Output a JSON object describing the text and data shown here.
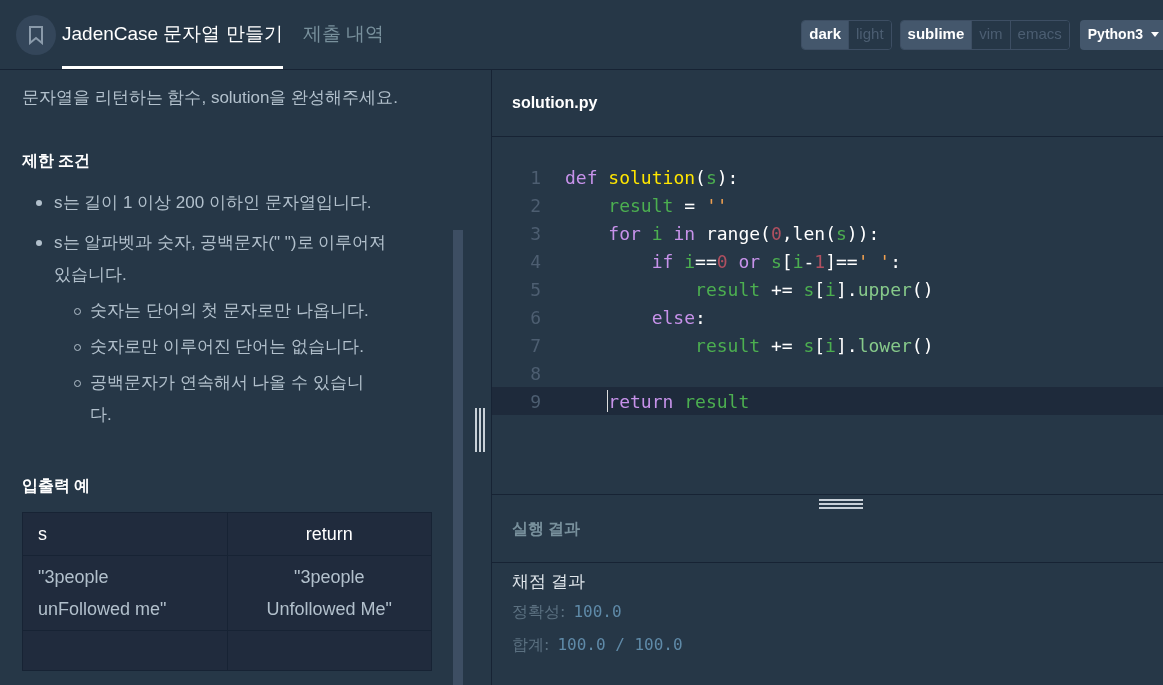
{
  "header": {
    "tabs": [
      {
        "label": "JadenCase 문자열 만들기",
        "selected": true
      },
      {
        "label": "제출 내역",
        "selected": false
      }
    ],
    "option_groups": [
      {
        "options": [
          {
            "label": "dark",
            "selected": true
          },
          {
            "label": "light",
            "selected": false
          }
        ]
      },
      {
        "options": [
          {
            "label": "sublime",
            "selected": true
          },
          {
            "label": "vim",
            "selected": false
          },
          {
            "label": "emacs",
            "selected": false
          }
        ]
      }
    ],
    "language": "Python3"
  },
  "description": {
    "intro": "문자열을 리턴하는 함수, solution을 완성해주세요.",
    "sections": [
      {
        "title": "제한 조건",
        "items": [
          {
            "text": "s는 길이 1 이상 200 이하인 문자열입니다."
          },
          {
            "text": "s는 알파벳과 숫자, 공백문자(\" \")로 이루어져 있습니다.",
            "children": [
              {
                "text": "숫자는 단어의 첫 문자로만 나옵니다."
              },
              {
                "text": "숫자로만 이루어진 단어는 없습니다."
              },
              {
                "text": "공백문자가 연속해서 나올 수 있습니다."
              }
            ]
          }
        ]
      },
      {
        "title": "입출력 예"
      }
    ],
    "table": {
      "columns": [
        "s",
        "return"
      ],
      "rows": [
        [
          "\"3people unFollowed me\"",
          "\"3people Unfollowed Me\""
        ]
      ]
    }
  },
  "editor": {
    "filename": "solution.py",
    "lines": [
      {
        "number": "1",
        "current": false,
        "tokens": [
          {
            "text": "def ",
            "kind": "kw"
          },
          {
            "text": "solution",
            "kind": "fn"
          },
          {
            "text": "(",
            "kind": "plain"
          },
          {
            "text": "s",
            "kind": "var"
          },
          {
            "text": "):",
            "kind": "plain"
          }
        ]
      },
      {
        "number": "2",
        "current": false,
        "tokens": [
          {
            "text": "    result",
            "kind": "var"
          },
          {
            "text": " = ",
            "kind": "plain"
          },
          {
            "text": "''",
            "kind": "str"
          }
        ]
      },
      {
        "number": "3",
        "current": false,
        "tokens": [
          {
            "text": "    for ",
            "kind": "kw"
          },
          {
            "text": "i ",
            "kind": "var"
          },
          {
            "text": "in ",
            "kind": "kw"
          },
          {
            "text": "range(",
            "kind": "plain"
          },
          {
            "text": "0",
            "kind": "num"
          },
          {
            "text": ",len(",
            "kind": "plain"
          },
          {
            "text": "s",
            "kind": "var"
          },
          {
            "text": ")):",
            "kind": "plain"
          }
        ]
      },
      {
        "number": "4",
        "current": false,
        "tokens": [
          {
            "text": "        if ",
            "kind": "kw"
          },
          {
            "text": "i",
            "kind": "var"
          },
          {
            "text": "==",
            "kind": "plain"
          },
          {
            "text": "0 ",
            "kind": "num"
          },
          {
            "text": "or ",
            "kind": "kw"
          },
          {
            "text": "s",
            "kind": "var"
          },
          {
            "text": "[",
            "kind": "plain"
          },
          {
            "text": "i",
            "kind": "var"
          },
          {
            "text": "-",
            "kind": "plain"
          },
          {
            "text": "1",
            "kind": "num"
          },
          {
            "text": "]==",
            "kind": "plain"
          },
          {
            "text": "' '",
            "kind": "str"
          },
          {
            "text": ":",
            "kind": "plain"
          }
        ]
      },
      {
        "number": "5",
        "current": false,
        "tokens": [
          {
            "text": "            result ",
            "kind": "var"
          },
          {
            "text": "+= ",
            "kind": "plain"
          },
          {
            "text": "s",
            "kind": "var"
          },
          {
            "text": "[",
            "kind": "plain"
          },
          {
            "text": "i",
            "kind": "var"
          },
          {
            "text": "].",
            "kind": "plain"
          },
          {
            "text": "upper",
            "kind": "method"
          },
          {
            "text": "()",
            "kind": "plain"
          }
        ]
      },
      {
        "number": "6",
        "current": false,
        "tokens": [
          {
            "text": "        else",
            "kind": "kw"
          },
          {
            "text": ":",
            "kind": "plain"
          }
        ]
      },
      {
        "number": "7",
        "current": false,
        "tokens": [
          {
            "text": "            result ",
            "kind": "var"
          },
          {
            "text": "+= ",
            "kind": "plain"
          },
          {
            "text": "s",
            "kind": "var"
          },
          {
            "text": "[",
            "kind": "plain"
          },
          {
            "text": "i",
            "kind": "var"
          },
          {
            "text": "].",
            "kind": "plain"
          },
          {
            "text": "lower",
            "kind": "method"
          },
          {
            "text": "()",
            "kind": "plain"
          }
        ]
      },
      {
        "number": "8",
        "current": false
      },
      {
        "number": "9",
        "current": true,
        "tokens": [
          {
            "text": "    return ",
            "kind": "kw"
          },
          {
            "text": "result",
            "kind": "var"
          }
        ]
      }
    ]
  },
  "result": {
    "title": "실행 결과",
    "output_title": "채점 결과",
    "lines": [
      {
        "label": "정확성:",
        "value": "100.0"
      },
      {
        "label": "합계:",
        "value": "100.0 / 100.0"
      }
    ]
  }
}
